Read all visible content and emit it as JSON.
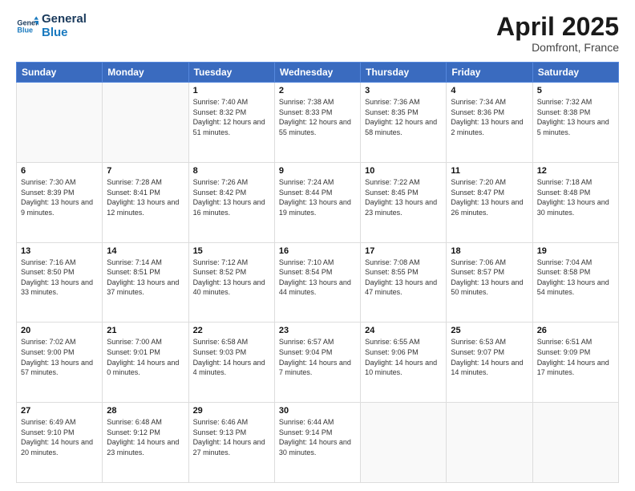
{
  "header": {
    "logo_line1": "General",
    "logo_line2": "Blue",
    "month_title": "April 2025",
    "location": "Domfront, France"
  },
  "weekdays": [
    "Sunday",
    "Monday",
    "Tuesday",
    "Wednesday",
    "Thursday",
    "Friday",
    "Saturday"
  ],
  "weeks": [
    [
      {
        "day": "",
        "info": ""
      },
      {
        "day": "",
        "info": ""
      },
      {
        "day": "1",
        "info": "Sunrise: 7:40 AM\nSunset: 8:32 PM\nDaylight: 12 hours and 51 minutes."
      },
      {
        "day": "2",
        "info": "Sunrise: 7:38 AM\nSunset: 8:33 PM\nDaylight: 12 hours and 55 minutes."
      },
      {
        "day": "3",
        "info": "Sunrise: 7:36 AM\nSunset: 8:35 PM\nDaylight: 12 hours and 58 minutes."
      },
      {
        "day": "4",
        "info": "Sunrise: 7:34 AM\nSunset: 8:36 PM\nDaylight: 13 hours and 2 minutes."
      },
      {
        "day": "5",
        "info": "Sunrise: 7:32 AM\nSunset: 8:38 PM\nDaylight: 13 hours and 5 minutes."
      }
    ],
    [
      {
        "day": "6",
        "info": "Sunrise: 7:30 AM\nSunset: 8:39 PM\nDaylight: 13 hours and 9 minutes."
      },
      {
        "day": "7",
        "info": "Sunrise: 7:28 AM\nSunset: 8:41 PM\nDaylight: 13 hours and 12 minutes."
      },
      {
        "day": "8",
        "info": "Sunrise: 7:26 AM\nSunset: 8:42 PM\nDaylight: 13 hours and 16 minutes."
      },
      {
        "day": "9",
        "info": "Sunrise: 7:24 AM\nSunset: 8:44 PM\nDaylight: 13 hours and 19 minutes."
      },
      {
        "day": "10",
        "info": "Sunrise: 7:22 AM\nSunset: 8:45 PM\nDaylight: 13 hours and 23 minutes."
      },
      {
        "day": "11",
        "info": "Sunrise: 7:20 AM\nSunset: 8:47 PM\nDaylight: 13 hours and 26 minutes."
      },
      {
        "day": "12",
        "info": "Sunrise: 7:18 AM\nSunset: 8:48 PM\nDaylight: 13 hours and 30 minutes."
      }
    ],
    [
      {
        "day": "13",
        "info": "Sunrise: 7:16 AM\nSunset: 8:50 PM\nDaylight: 13 hours and 33 minutes."
      },
      {
        "day": "14",
        "info": "Sunrise: 7:14 AM\nSunset: 8:51 PM\nDaylight: 13 hours and 37 minutes."
      },
      {
        "day": "15",
        "info": "Sunrise: 7:12 AM\nSunset: 8:52 PM\nDaylight: 13 hours and 40 minutes."
      },
      {
        "day": "16",
        "info": "Sunrise: 7:10 AM\nSunset: 8:54 PM\nDaylight: 13 hours and 44 minutes."
      },
      {
        "day": "17",
        "info": "Sunrise: 7:08 AM\nSunset: 8:55 PM\nDaylight: 13 hours and 47 minutes."
      },
      {
        "day": "18",
        "info": "Sunrise: 7:06 AM\nSunset: 8:57 PM\nDaylight: 13 hours and 50 minutes."
      },
      {
        "day": "19",
        "info": "Sunrise: 7:04 AM\nSunset: 8:58 PM\nDaylight: 13 hours and 54 minutes."
      }
    ],
    [
      {
        "day": "20",
        "info": "Sunrise: 7:02 AM\nSunset: 9:00 PM\nDaylight: 13 hours and 57 minutes."
      },
      {
        "day": "21",
        "info": "Sunrise: 7:00 AM\nSunset: 9:01 PM\nDaylight: 14 hours and 0 minutes."
      },
      {
        "day": "22",
        "info": "Sunrise: 6:58 AM\nSunset: 9:03 PM\nDaylight: 14 hours and 4 minutes."
      },
      {
        "day": "23",
        "info": "Sunrise: 6:57 AM\nSunset: 9:04 PM\nDaylight: 14 hours and 7 minutes."
      },
      {
        "day": "24",
        "info": "Sunrise: 6:55 AM\nSunset: 9:06 PM\nDaylight: 14 hours and 10 minutes."
      },
      {
        "day": "25",
        "info": "Sunrise: 6:53 AM\nSunset: 9:07 PM\nDaylight: 14 hours and 14 minutes."
      },
      {
        "day": "26",
        "info": "Sunrise: 6:51 AM\nSunset: 9:09 PM\nDaylight: 14 hours and 17 minutes."
      }
    ],
    [
      {
        "day": "27",
        "info": "Sunrise: 6:49 AM\nSunset: 9:10 PM\nDaylight: 14 hours and 20 minutes."
      },
      {
        "day": "28",
        "info": "Sunrise: 6:48 AM\nSunset: 9:12 PM\nDaylight: 14 hours and 23 minutes."
      },
      {
        "day": "29",
        "info": "Sunrise: 6:46 AM\nSunset: 9:13 PM\nDaylight: 14 hours and 27 minutes."
      },
      {
        "day": "30",
        "info": "Sunrise: 6:44 AM\nSunset: 9:14 PM\nDaylight: 14 hours and 30 minutes."
      },
      {
        "day": "",
        "info": ""
      },
      {
        "day": "",
        "info": ""
      },
      {
        "day": "",
        "info": ""
      }
    ]
  ]
}
